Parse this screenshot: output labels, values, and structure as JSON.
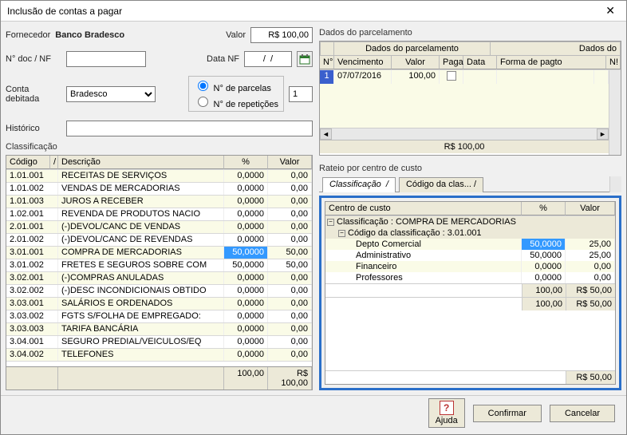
{
  "window": {
    "title": "Inclusão de contas a pagar"
  },
  "header": {
    "fornecedor_label": "Fornecedor",
    "fornecedor_value": "Banco Bradesco",
    "valor_label": "Valor",
    "valor_value": "R$ 100,00",
    "ndoc_label": "N° doc / NF",
    "ndoc_value": "",
    "datanf_label": "Data NF",
    "datanf_value": "/  /",
    "conta_label": "Conta debitada",
    "conta_value": "Bradesco",
    "radio_parcelas": "N° de parcelas",
    "radio_repeticoes": "N° de repetições",
    "parcelas_value": "1",
    "historico_label": "Histórico",
    "historico_value": ""
  },
  "classificacao": {
    "title": "Classificação",
    "cols": {
      "codigo": "Código",
      "descricao": "Descrição",
      "percent": "%",
      "valor": "Valor"
    },
    "rows": [
      {
        "codigo": "1.01.001",
        "descricao": "RECEITAS DE SERVIÇOS",
        "percent": "0,0000",
        "valor": "0,00",
        "sel": false
      },
      {
        "codigo": "1.01.002",
        "descricao": "VENDAS DE MERCADORIAS",
        "percent": "0,0000",
        "valor": "0,00",
        "sel": false
      },
      {
        "codigo": "1.01.003",
        "descricao": "JUROS A RECEBER",
        "percent": "0,0000",
        "valor": "0,00",
        "sel": false
      },
      {
        "codigo": "1.02.001",
        "descricao": "REVENDA DE PRODUTOS NACIO",
        "percent": "0,0000",
        "valor": "0,00",
        "sel": false
      },
      {
        "codigo": "2.01.001",
        "descricao": "(-)DEVOL/CANC DE VENDAS",
        "percent": "0,0000",
        "valor": "0,00",
        "sel": false
      },
      {
        "codigo": "2.01.002",
        "descricao": "(-)DEVOL/CANC DE REVENDAS",
        "percent": "0,0000",
        "valor": "0,00",
        "sel": false
      },
      {
        "codigo": "3.01.001",
        "descricao": "COMPRA DE MERCADORIAS",
        "percent": "50,0000",
        "valor": "50,00",
        "sel": true
      },
      {
        "codigo": "3.01.002",
        "descricao": "FRETES E SEGUROS SOBRE COM",
        "percent": "50,0000",
        "valor": "50,00",
        "sel": false
      },
      {
        "codigo": "3.02.001",
        "descricao": "(-)COMPRAS ANULADAS",
        "percent": "0,0000",
        "valor": "0,00",
        "sel": false
      },
      {
        "codigo": "3.02.002",
        "descricao": "(-)DESC INCONDICIONAIS OBTIDO",
        "percent": "0,0000",
        "valor": "0,00",
        "sel": false
      },
      {
        "codigo": "3.03.001",
        "descricao": "SALÁRIOS E ORDENADOS",
        "percent": "0,0000",
        "valor": "0,00",
        "sel": false
      },
      {
        "codigo": "3.03.002",
        "descricao": "FGTS S/FOLHA DE EMPREGADO:",
        "percent": "0,0000",
        "valor": "0,00",
        "sel": false
      },
      {
        "codigo": "3.03.003",
        "descricao": "TARIFA BANCÁRIA",
        "percent": "0,0000",
        "valor": "0,00",
        "sel": false
      },
      {
        "codigo": "3.04.001",
        "descricao": "SEGURO PREDIAL/VEICULOS/EQ",
        "percent": "0,0000",
        "valor": "0,00",
        "sel": false
      },
      {
        "codigo": "3.04.002",
        "descricao": "TELEFONES",
        "percent": "0,0000",
        "valor": "0,00",
        "sel": false
      }
    ],
    "footer": {
      "percent": "100,00",
      "valor": "R$ 100,00"
    }
  },
  "parcelamento": {
    "title": "Dados do parcelamento",
    "head1_left": "Dados do parcelamento",
    "head1_right": "Dados do",
    "cols": {
      "n": "N°",
      "venc": "Vencimento",
      "valor": "Valor",
      "paga": "Paga",
      "data": "Data",
      "forma": "Forma de pagto",
      "extra": "N!"
    },
    "rows": [
      {
        "n": "1",
        "venc": "07/07/2016",
        "valor": "100,00",
        "paga": false,
        "data": "",
        "forma": ""
      }
    ],
    "total": "R$ 100,00"
  },
  "rateio": {
    "title": "Rateio por centro de custo",
    "tab1": "Classificação",
    "tab2": "Código da clas... /",
    "cols": {
      "cc": "Centro de custo",
      "percent": "%",
      "valor": "Valor"
    },
    "group1": "Classificação : COMPRA DE MERCADORIAS",
    "group2": "Código da classificação : 3.01.001",
    "rows": [
      {
        "cc": "Depto Comercial",
        "percent": "50,0000",
        "valor": "25,00",
        "sel": true
      },
      {
        "cc": "Administrativo",
        "percent": "50,0000",
        "valor": "25,00",
        "sel": false
      },
      {
        "cc": "Financeiro",
        "percent": "0,0000",
        "valor": "0,00",
        "sel": false
      },
      {
        "cc": "Professores",
        "percent": "0,0000",
        "valor": "0,00",
        "sel": false
      }
    ],
    "sub1": {
      "percent": "100,00",
      "valor": "R$ 50,00"
    },
    "sub2": {
      "percent": "100,00",
      "valor": "R$ 50,00"
    },
    "grand": {
      "valor": "R$ 50,00"
    }
  },
  "buttons": {
    "ajuda": "Ajuda",
    "confirmar": "Confirmar",
    "cancelar": "Cancelar"
  }
}
